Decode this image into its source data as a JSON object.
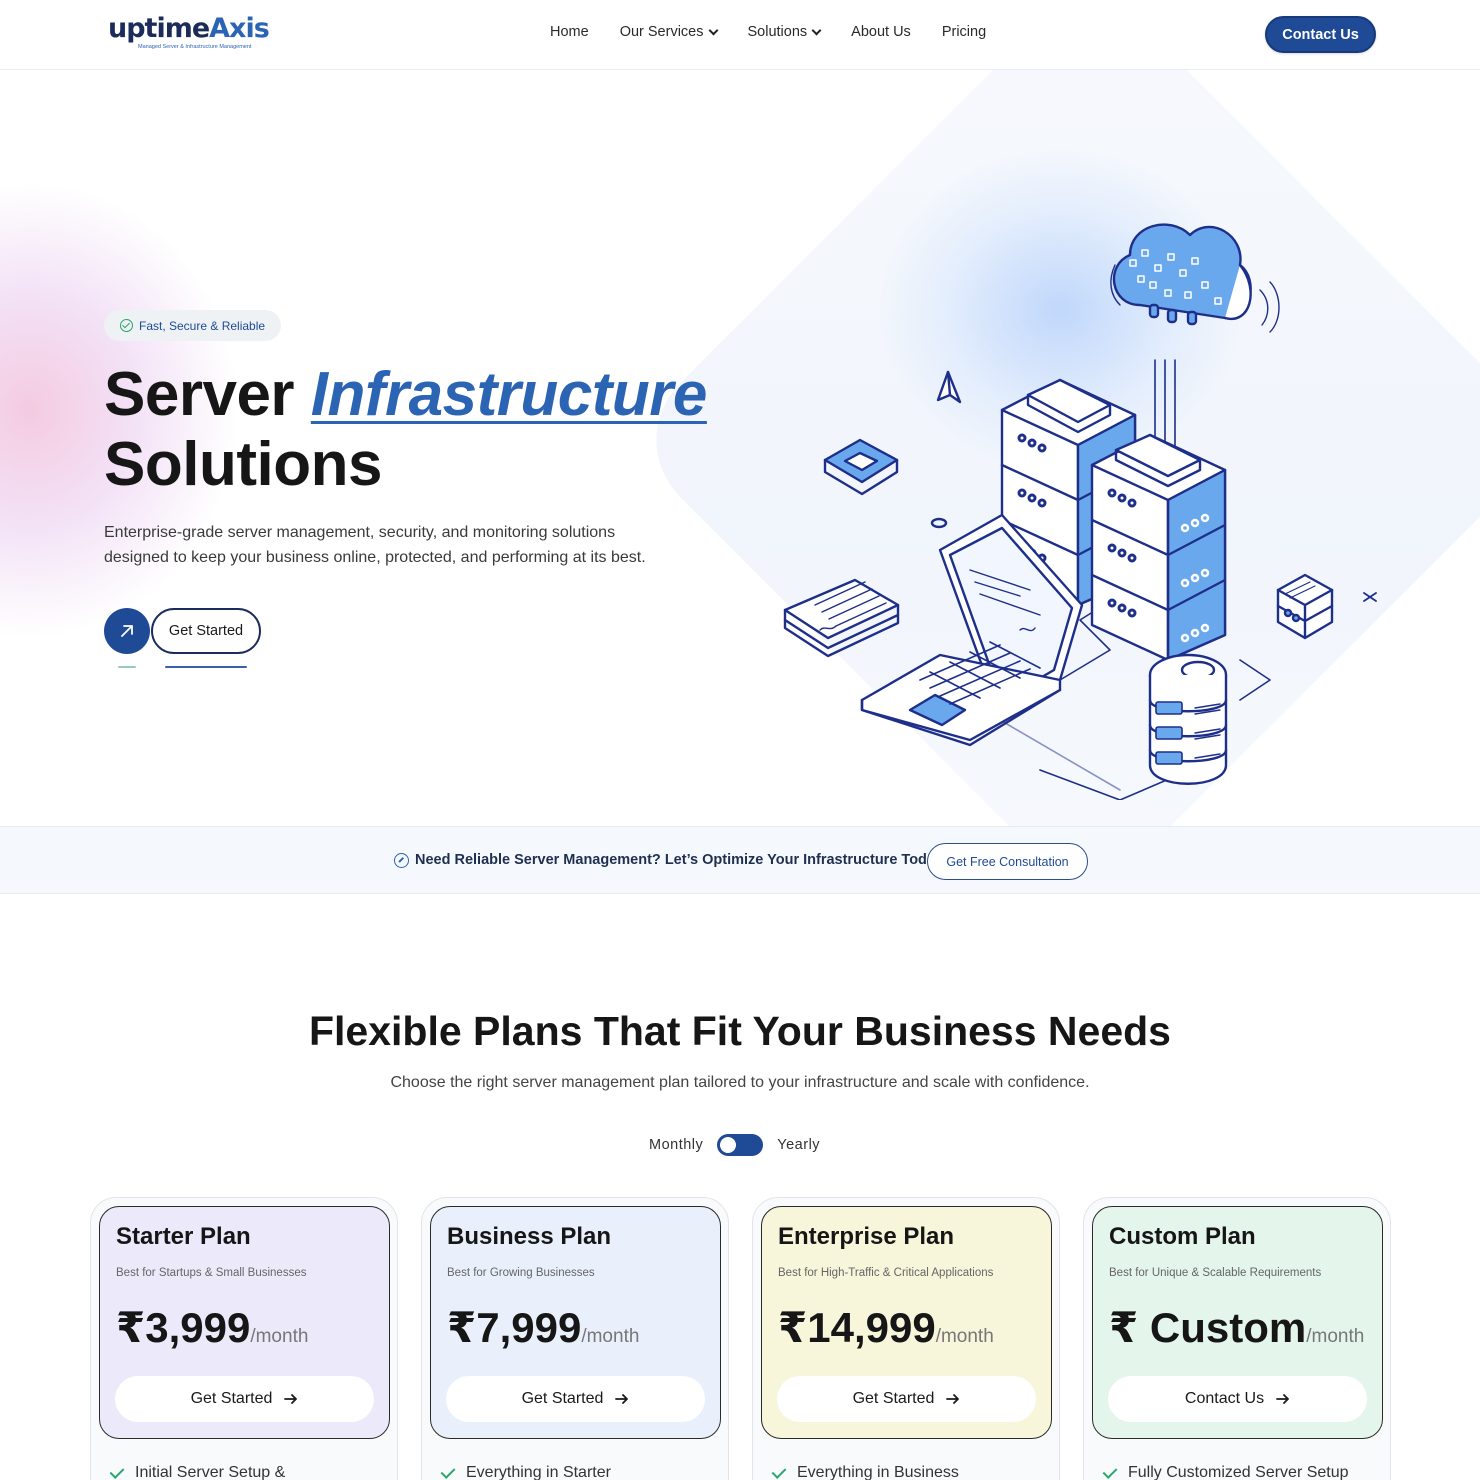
{
  "brand": {
    "logo_main_a": "uptime",
    "logo_main_b": "Axis",
    "logo_sub": "Managed Server & Infrastructure Management"
  },
  "nav": {
    "items": [
      {
        "label": "Home"
      },
      {
        "label": "Our Services",
        "dropdown": true
      },
      {
        "label": "Solutions",
        "dropdown": true
      },
      {
        "label": "About Us"
      },
      {
        "label": "Pricing"
      }
    ],
    "contact_label": "Contact Us"
  },
  "hero": {
    "badge": "Fast, Secure & Reliable",
    "title_1": "Server ",
    "title_highlight": "Infrastructure",
    "title_2": "Solutions",
    "description": "Enterprise-grade server management, security, and monitoring solutions designed to keep your business online, protected, and performing at its best.",
    "cta_label": "Get Started"
  },
  "cta_strip": {
    "text": "Need Reliable Server Management? Let’s Optimize Your Infrastructure Today.",
    "button": "Get Free Consultation"
  },
  "pricing": {
    "title": "Flexible Plans That Fit Your Business Needs",
    "subtitle": "Choose the right server management plan tailored to your infrastructure and scale with confidence.",
    "toggle_monthly": "Monthly",
    "toggle_yearly": "Yearly",
    "plans": [
      {
        "name": "Starter Plan",
        "sub": "Best for Startups & Small Businesses",
        "price": "₹3,999",
        "per": "/month",
        "button": "Get Started",
        "feature": "Initial Server Setup &",
        "bg": "#ece9fb"
      },
      {
        "name": "Business Plan",
        "sub": "Best for Growing Businesses",
        "price": "₹7,999",
        "per": "/month",
        "button": "Get Started",
        "feature": "Everything in Starter",
        "bg": "#e9f0fc"
      },
      {
        "name": "Enterprise Plan",
        "sub": "Best for High-Traffic & Critical Applications",
        "price": "₹14,999",
        "per": "/month",
        "button": "Get Started",
        "feature": "Everything in Business",
        "bg": "#f7f5da"
      },
      {
        "name": "Custom Plan",
        "sub": "Best for Unique & Scalable Requirements",
        "price": "₹ Custom",
        "per": "/month",
        "button": "Contact Us",
        "feature": "Fully Customized Server Setup",
        "bg": "#e4f5ec"
      }
    ]
  },
  "colors": {
    "primary": "#1f4a96",
    "accent": "#2c64b4",
    "check": "#2aa66a"
  }
}
